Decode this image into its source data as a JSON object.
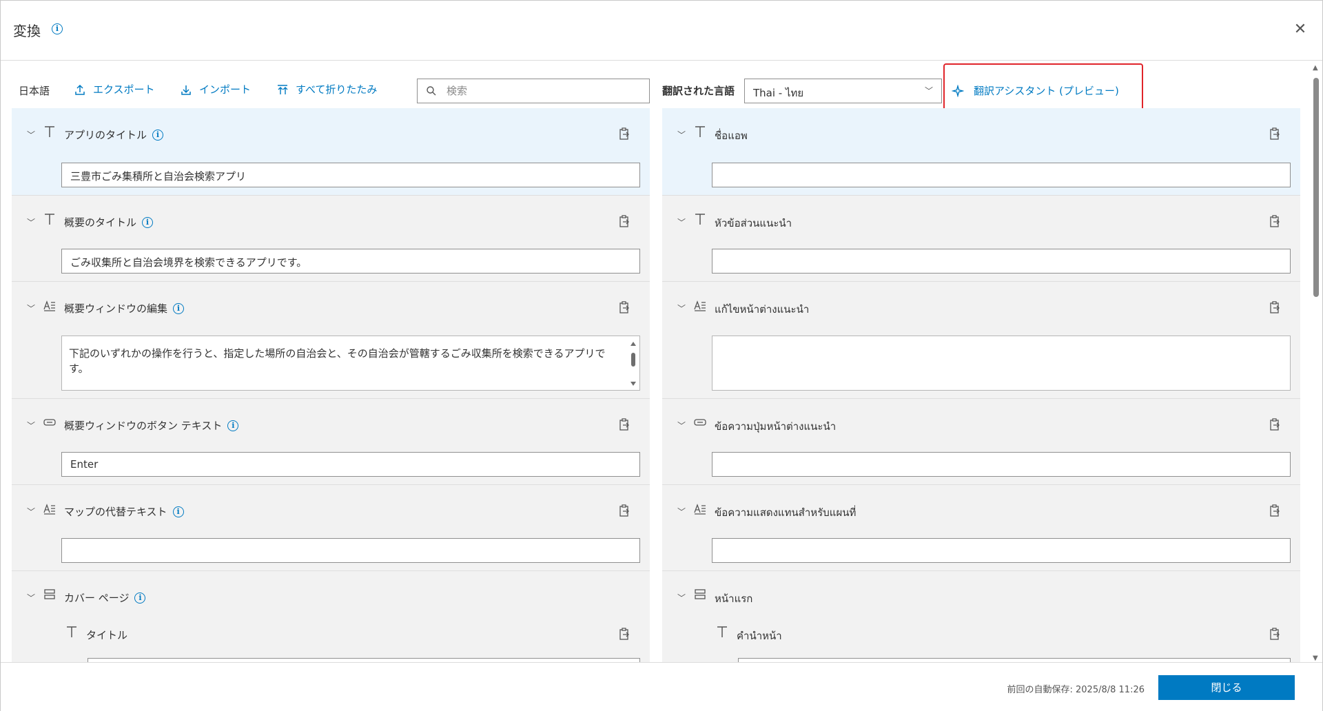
{
  "dialog": {
    "title": "変換",
    "close_icon": "close-icon"
  },
  "source_toolbar": {
    "language": "日本語",
    "export_label": "エクスポート",
    "import_label": "インポート",
    "collapse_all_label": "すべて折りたたみ",
    "search_placeholder": "検索"
  },
  "target_toolbar": {
    "label": "翻訳された言語",
    "selected_language": "Thai - ไทย",
    "assistant_label": "翻訳アシスタント (プレビュー)",
    "highlight_color": "#e0242a"
  },
  "source_rows": [
    {
      "label": "アプリのタイトル",
      "icon": "text-icon",
      "value": "三豊市ごみ集積所と自治会検索アプリ"
    },
    {
      "label": "概要のタイトル",
      "icon": "text-icon",
      "value": "ごみ収集所と自治会境界を検索できるアプリです。"
    },
    {
      "label": "概要ウィンドウの編集",
      "icon": "rich-text-icon",
      "value": "下記のいずれかの操作を行うと、指定した場所の自治会と、その自治会が管轄するごみ収集所を検索できるアプリです。"
    },
    {
      "label": "概要ウィンドウのボタン テキスト",
      "icon": "button-icon",
      "value": "Enter"
    },
    {
      "label": "マップの代替テキスト",
      "icon": "rich-text-icon",
      "value": ""
    },
    {
      "label": "カバー ページ",
      "icon": "section-icon",
      "sub_label": "タイトル",
      "sub_icon": "text-icon"
    }
  ],
  "target_rows": [
    {
      "label": "ชื่อแอพ",
      "value": ""
    },
    {
      "label": "หัวข้อส่วนแนะนำ",
      "value": ""
    },
    {
      "label": "แก้ไขหน้าต่างแนะนำ",
      "value": ""
    },
    {
      "label": "ข้อความปุ่มหน้าต่างแนะนำ",
      "value": ""
    },
    {
      "label": "ข้อความแสดงแทนสำหรับแผนที่",
      "value": ""
    },
    {
      "label": "หน้าแรก",
      "sub_label": "คำนำหน้า"
    }
  ],
  "footer": {
    "autosave": "前回の自動保存: 2025/8/8 11:26",
    "close_label": "閉じる"
  },
  "colors": {
    "accent": "#007ac2",
    "active_row": "#eaf4fc",
    "row_bg": "#f2f2f2"
  }
}
